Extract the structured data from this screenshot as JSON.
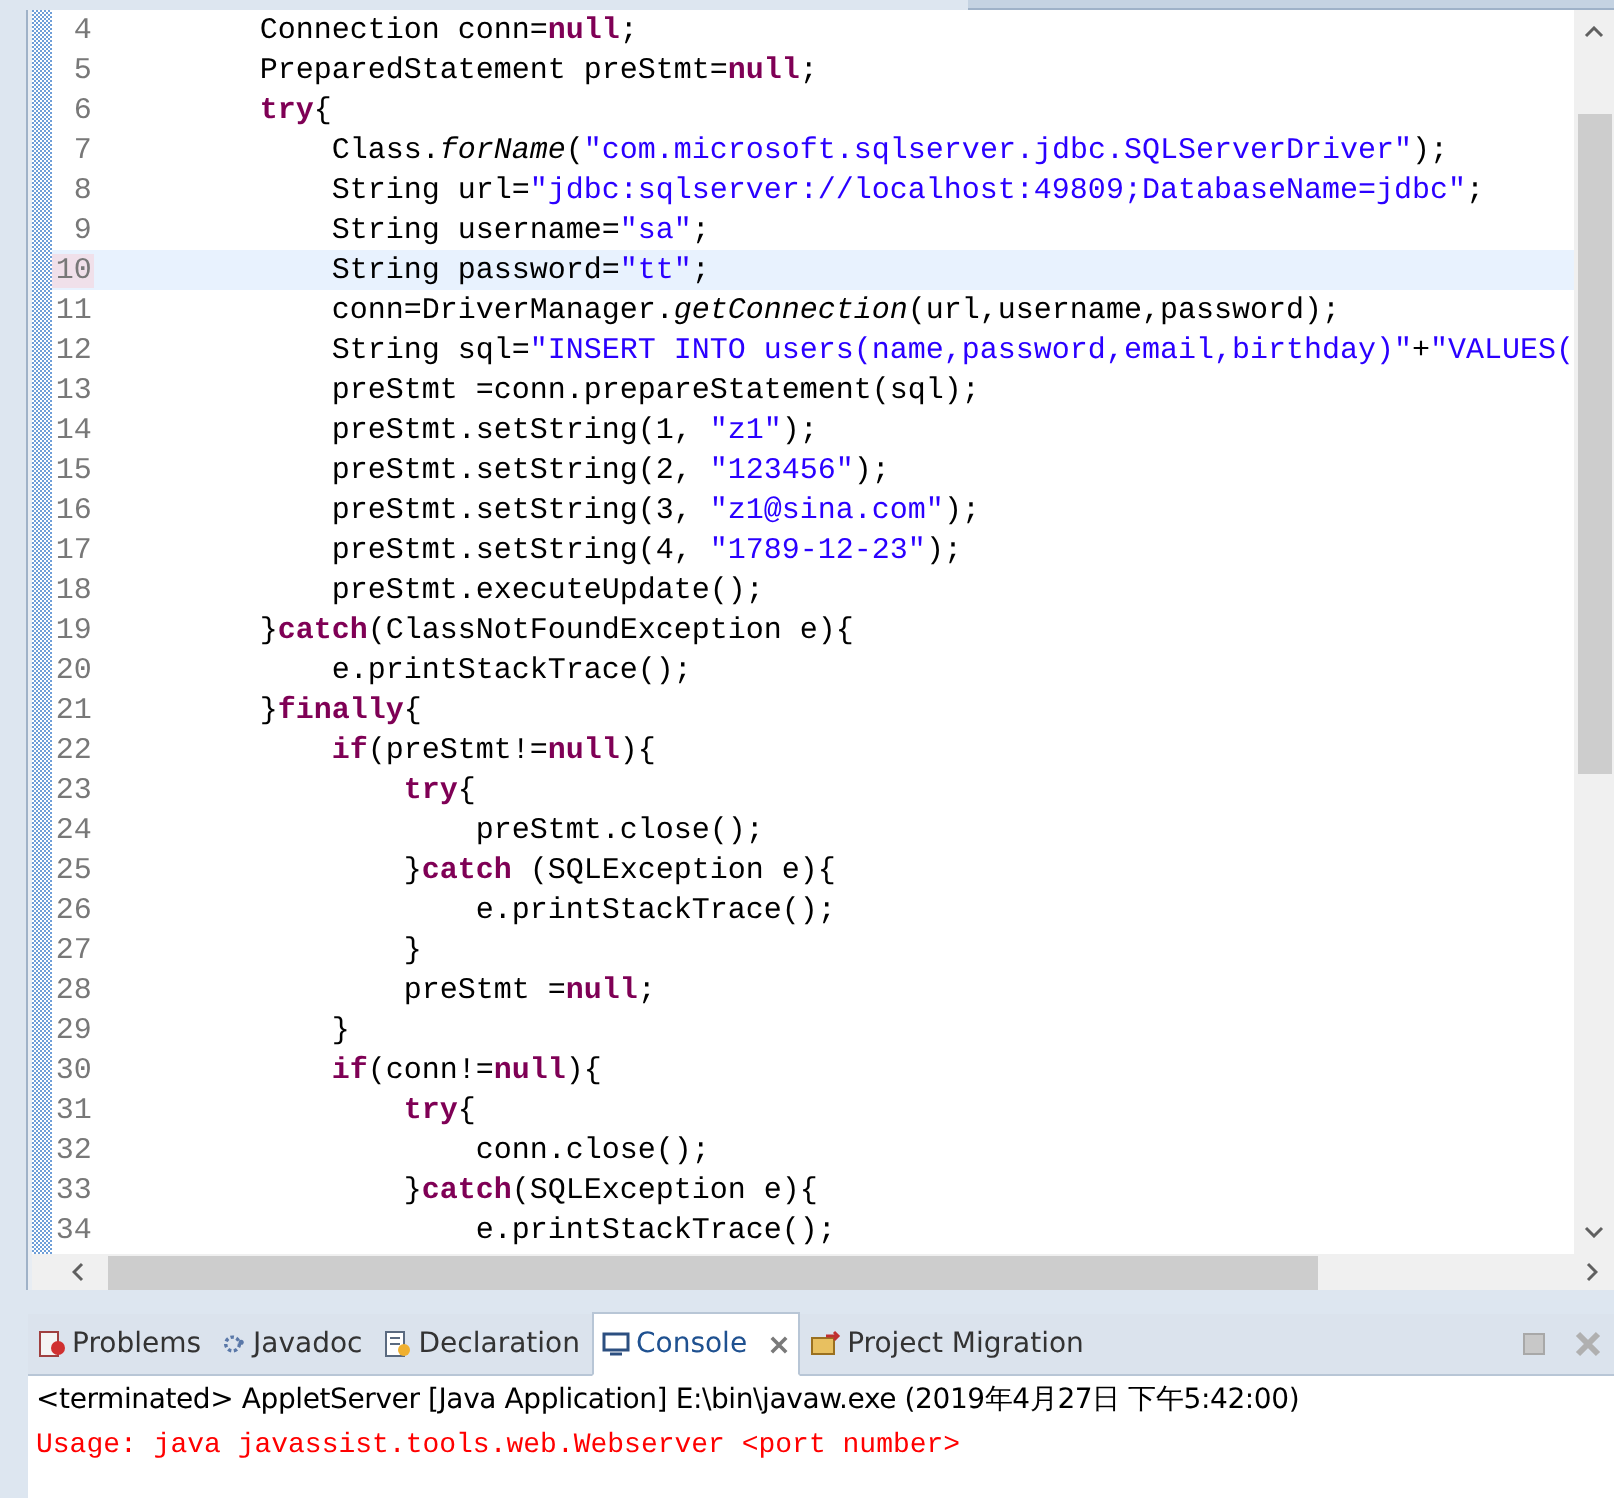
{
  "editor": {
    "lines": [
      {
        "number": "4",
        "current": false,
        "tokens": [
          {
            "kind": "plain",
            "text": "        Connection conn="
          },
          {
            "kind": "keyword",
            "text": "null"
          },
          {
            "kind": "plain",
            "text": ";"
          }
        ]
      },
      {
        "number": "5",
        "current": false,
        "tokens": [
          {
            "kind": "plain",
            "text": "        PreparedStatement preStmt="
          },
          {
            "kind": "keyword",
            "text": "null"
          },
          {
            "kind": "plain",
            "text": ";"
          }
        ]
      },
      {
        "number": "6",
        "current": false,
        "tokens": [
          {
            "kind": "keyword",
            "text": "        try"
          },
          {
            "kind": "plain",
            "text": "{"
          }
        ]
      },
      {
        "number": "7",
        "current": false,
        "tokens": [
          {
            "kind": "plain",
            "text": "            Class."
          },
          {
            "kind": "italic",
            "text": "forName"
          },
          {
            "kind": "plain",
            "text": "("
          },
          {
            "kind": "string",
            "text": "\"com.microsoft.sqlserver.jdbc.SQLServerDriver\""
          },
          {
            "kind": "plain",
            "text": ");"
          }
        ]
      },
      {
        "number": "8",
        "current": false,
        "tokens": [
          {
            "kind": "plain",
            "text": "            String url="
          },
          {
            "kind": "string",
            "text": "\"jdbc:sqlserver://localhost:49809;DatabaseName=jdbc\""
          },
          {
            "kind": "plain",
            "text": ";"
          }
        ]
      },
      {
        "number": "9",
        "current": false,
        "tokens": [
          {
            "kind": "plain",
            "text": "            String username="
          },
          {
            "kind": "string",
            "text": "\"sa\""
          },
          {
            "kind": "plain",
            "text": ";"
          }
        ]
      },
      {
        "number": "10",
        "current": true,
        "tokens": [
          {
            "kind": "plain",
            "text": "            String password="
          },
          {
            "kind": "string",
            "text": "\"tt\""
          },
          {
            "kind": "plain",
            "text": ";"
          }
        ]
      },
      {
        "number": "11",
        "current": false,
        "tokens": [
          {
            "kind": "plain",
            "text": "            conn=DriverManager."
          },
          {
            "kind": "italic",
            "text": "getConnection"
          },
          {
            "kind": "plain",
            "text": "(url,username,password);"
          }
        ]
      },
      {
        "number": "12",
        "current": false,
        "tokens": [
          {
            "kind": "plain",
            "text": "            String sql="
          },
          {
            "kind": "string",
            "text": "\"INSERT INTO users(name,password,email,birthday)\""
          },
          {
            "kind": "plain",
            "text": "+"
          },
          {
            "kind": "string",
            "text": "\"VALUES("
          }
        ]
      },
      {
        "number": "13",
        "current": false,
        "tokens": [
          {
            "kind": "plain",
            "text": "            preStmt =conn.prepareStatement(sql);"
          }
        ]
      },
      {
        "number": "14",
        "current": false,
        "tokens": [
          {
            "kind": "plain",
            "text": "            preStmt.setString(1, "
          },
          {
            "kind": "string",
            "text": "\"z1\""
          },
          {
            "kind": "plain",
            "text": ");"
          }
        ]
      },
      {
        "number": "15",
        "current": false,
        "tokens": [
          {
            "kind": "plain",
            "text": "            preStmt.setString(2, "
          },
          {
            "kind": "string",
            "text": "\"123456\""
          },
          {
            "kind": "plain",
            "text": ");"
          }
        ]
      },
      {
        "number": "16",
        "current": false,
        "tokens": [
          {
            "kind": "plain",
            "text": "            preStmt.setString(3, "
          },
          {
            "kind": "string",
            "text": "\"z1@sina.com\""
          },
          {
            "kind": "plain",
            "text": ");"
          }
        ]
      },
      {
        "number": "17",
        "current": false,
        "tokens": [
          {
            "kind": "plain",
            "text": "            preStmt.setString(4, "
          },
          {
            "kind": "string",
            "text": "\"1789-12-23\""
          },
          {
            "kind": "plain",
            "text": ");"
          }
        ]
      },
      {
        "number": "18",
        "current": false,
        "tokens": [
          {
            "kind": "plain",
            "text": "            preStmt.executeUpdate();"
          }
        ]
      },
      {
        "number": "19",
        "current": false,
        "tokens": [
          {
            "kind": "plain",
            "text": "        }"
          },
          {
            "kind": "keyword",
            "text": "catch"
          },
          {
            "kind": "plain",
            "text": "(ClassNotFoundException e){"
          }
        ]
      },
      {
        "number": "20",
        "current": false,
        "tokens": [
          {
            "kind": "plain",
            "text": "            e.printStackTrace();"
          }
        ]
      },
      {
        "number": "21",
        "current": false,
        "tokens": [
          {
            "kind": "plain",
            "text": "        }"
          },
          {
            "kind": "keyword",
            "text": "finally"
          },
          {
            "kind": "plain",
            "text": "{"
          }
        ]
      },
      {
        "number": "22",
        "current": false,
        "tokens": [
          {
            "kind": "keyword",
            "text": "            if"
          },
          {
            "kind": "plain",
            "text": "(preStmt!="
          },
          {
            "kind": "keyword",
            "text": "null"
          },
          {
            "kind": "plain",
            "text": "){"
          }
        ]
      },
      {
        "number": "23",
        "current": false,
        "tokens": [
          {
            "kind": "keyword",
            "text": "                try"
          },
          {
            "kind": "plain",
            "text": "{"
          }
        ]
      },
      {
        "number": "24",
        "current": false,
        "tokens": [
          {
            "kind": "plain",
            "text": "                    preStmt.close();"
          }
        ]
      },
      {
        "number": "25",
        "current": false,
        "tokens": [
          {
            "kind": "plain",
            "text": "                }"
          },
          {
            "kind": "keyword",
            "text": "catch"
          },
          {
            "kind": "plain",
            "text": " (SQLException e){"
          }
        ]
      },
      {
        "number": "26",
        "current": false,
        "tokens": [
          {
            "kind": "plain",
            "text": "                    e.printStackTrace();"
          }
        ]
      },
      {
        "number": "27",
        "current": false,
        "tokens": [
          {
            "kind": "plain",
            "text": "                }"
          }
        ]
      },
      {
        "number": "28",
        "current": false,
        "tokens": [
          {
            "kind": "plain",
            "text": "                preStmt ="
          },
          {
            "kind": "keyword",
            "text": "null"
          },
          {
            "kind": "plain",
            "text": ";"
          }
        ]
      },
      {
        "number": "29",
        "current": false,
        "tokens": [
          {
            "kind": "plain",
            "text": "            }"
          }
        ]
      },
      {
        "number": "30",
        "current": false,
        "tokens": [
          {
            "kind": "keyword",
            "text": "            if"
          },
          {
            "kind": "plain",
            "text": "(conn!="
          },
          {
            "kind": "keyword",
            "text": "null"
          },
          {
            "kind": "plain",
            "text": "){"
          }
        ]
      },
      {
        "number": "31",
        "current": false,
        "tokens": [
          {
            "kind": "keyword",
            "text": "                try"
          },
          {
            "kind": "plain",
            "text": "{"
          }
        ]
      },
      {
        "number": "32",
        "current": false,
        "tokens": [
          {
            "kind": "plain",
            "text": "                    conn.close();"
          }
        ]
      },
      {
        "number": "33",
        "current": false,
        "tokens": [
          {
            "kind": "plain",
            "text": "                }"
          },
          {
            "kind": "keyword",
            "text": "catch"
          },
          {
            "kind": "plain",
            "text": "(SQLException e){"
          }
        ]
      },
      {
        "number": "34",
        "current": false,
        "tokens": [
          {
            "kind": "plain",
            "text": "                    e.printStackTrace();"
          }
        ]
      }
    ]
  },
  "panel": {
    "tabs": [
      {
        "label": "Problems",
        "selected": false
      },
      {
        "label": "Javadoc",
        "selected": false
      },
      {
        "label": "Declaration",
        "selected": false
      },
      {
        "label": "Console",
        "selected": true
      },
      {
        "label": "Project Migration",
        "selected": false
      }
    ],
    "console": {
      "header": "<terminated> AppletServer [Java Application] E:\\bin\\javaw.exe (2019年4月27日 下午5:42:00)",
      "output": [
        {
          "kind": "error",
          "text": "Usage: java javassist.tools.web.Webserver <port number>"
        }
      ]
    }
  }
}
